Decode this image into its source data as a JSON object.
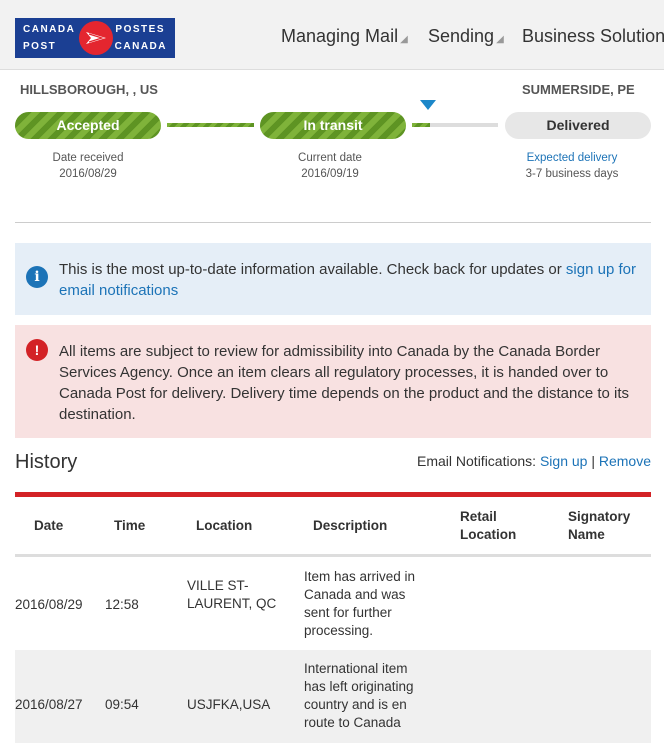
{
  "header": {
    "logo": {
      "top_left": "CANADA",
      "bottom_left": "POST",
      "top_right": "POSTES",
      "bottom_right": "CANADA"
    },
    "nav": [
      {
        "label": "Managing Mail"
      },
      {
        "label": "Sending"
      },
      {
        "label": "Business Solution"
      }
    ]
  },
  "tracking": {
    "origin": "HILLSBOROUGH, , US",
    "destination": "SUMMERSIDE, PE",
    "steps": [
      {
        "label": "Accepted",
        "caption": "Date received",
        "value": "2016/08/29"
      },
      {
        "label": "In transit",
        "caption": "Current date",
        "value": "2016/09/19"
      },
      {
        "label": "Delivered",
        "caption": "Expected delivery",
        "value": "3-7 business days"
      }
    ]
  },
  "alerts": {
    "info_text": "This is the most up-to-date information available. Check back for updates or ",
    "info_link": "sign up for email notifications",
    "error_text": "All items are subject to review for admissibility into Canada by the Canada Border Services Agency. Once an item clears all regulatory processes, it is handed over to Canada Post for delivery. Delivery time depends on the product and the distance to its destination."
  },
  "history": {
    "title": "History",
    "email_label": "Email Notifications: ",
    "signup": "Sign up",
    "separator": " | ",
    "remove": "Remove",
    "columns": [
      "Date",
      "Time",
      "Location",
      "Description",
      "Retail Location",
      "Signatory Name"
    ],
    "rows": [
      {
        "date": "2016/08/29",
        "time": "12:58",
        "location": "VILLE ST-LAURENT, QC",
        "description": "Item has arrived in Canada and was sent for further processing.",
        "retail": "",
        "signatory": ""
      },
      {
        "date": "2016/08/27",
        "time": "09:54",
        "location": "USJFKA,USA",
        "description": "International item has left originating country and is en route to Canada",
        "retail": "",
        "signatory": ""
      }
    ]
  }
}
